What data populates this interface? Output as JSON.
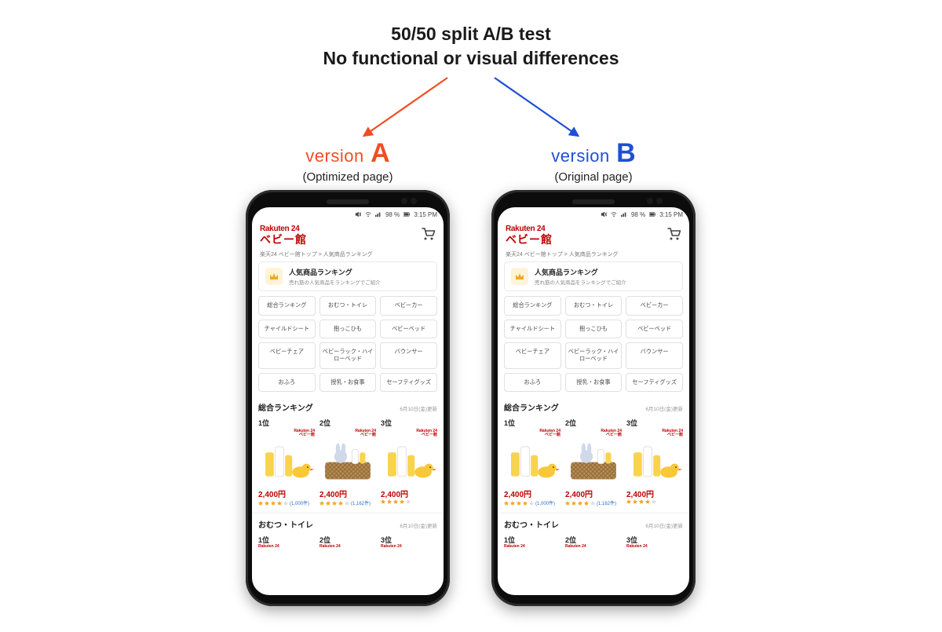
{
  "headline": {
    "line1": "50/50 split A/B test",
    "line2": "No functional or visual differences"
  },
  "versions": {
    "A": {
      "prefix": "version",
      "letter": "A",
      "subtitle": "(Optimized page)"
    },
    "B": {
      "prefix": "version",
      "letter": "B",
      "subtitle": "(Original page)"
    }
  },
  "statusbar": {
    "battery": "98 %",
    "time": "3:15 PM"
  },
  "app": {
    "brand_line1": "Rakuten 24",
    "brand_line2": "ベビー館",
    "breadcrumb": "楽天24 ベビー館トップ > 人気商品ランキング",
    "ranking": {
      "title": "人気商品ランキング",
      "desc": "売れ筋の人気商品をランキングでご紹介"
    },
    "categories": [
      "総合ランキング",
      "おむつ・トイレ",
      "ベビーカー",
      "チャイルドシート",
      "抱っこひも",
      "ベビーベッド",
      "ベビーチェア",
      "ベビーラック・ハイローベッド",
      "バウンサー",
      "おふろ",
      "授乳・お食事",
      "セーフティグッズ"
    ],
    "section1": {
      "title": "総合ランキング",
      "updated": "6月10日(金)更新",
      "products": [
        {
          "rank": "1位",
          "price": "2,400円",
          "reviews": "(1,000件)"
        },
        {
          "rank": "2位",
          "price": "2,400円",
          "reviews": "(1,162件)"
        },
        {
          "rank": "3位",
          "price": "2,400円",
          "reviews": ""
        }
      ]
    },
    "section2": {
      "title": "おむつ・トイレ",
      "updated": "6月10日(金)更新",
      "ranks": [
        "1位",
        "2位",
        "3位"
      ]
    },
    "mini_brand": {
      "l1": "Rakuten 24",
      "l2": "ベビー館"
    }
  },
  "colors": {
    "rakuten_red": "#bf0000",
    "versionA": "#ef4e23",
    "versionB": "#1f4fd6"
  }
}
